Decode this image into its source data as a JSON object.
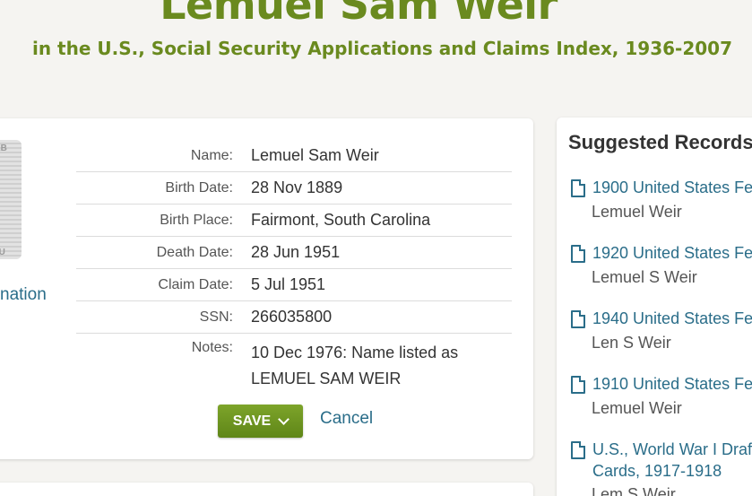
{
  "header": {
    "title": "Lemuel Sam Weir",
    "subtitle": "in the U.S., Social Security Applications and Claims Index, 1936-2007"
  },
  "image_panel": {
    "thumb_top_text": "EB",
    "thumb_bottom_text": "PU",
    "side_link": "nation"
  },
  "record": {
    "fields": [
      {
        "label": "Name:",
        "value": "Lemuel Sam Weir"
      },
      {
        "label": "Birth Date:",
        "value": "28 Nov 1889"
      },
      {
        "label": "Birth Place:",
        "value": "Fairmont, South Carolina"
      },
      {
        "label": "Death Date:",
        "value": "28 Jun 1951"
      },
      {
        "label": "Claim Date:",
        "value": "5 Jul 1951"
      },
      {
        "label": "SSN:",
        "value": "266035800"
      },
      {
        "label": "Notes:",
        "value": "10 Dec 1976: Name listed as LEMUEL SAM WEIR"
      }
    ],
    "save_label": "SAVE",
    "cancel_label": "Cancel"
  },
  "suggested": {
    "title": "Suggested Records",
    "items": [
      {
        "title": "1900 United States Fe",
        "name": "Lemuel Weir"
      },
      {
        "title": "1920 United States Fe",
        "name": "Lemuel S Weir"
      },
      {
        "title": "1940 United States Fe",
        "name": "Len S Weir"
      },
      {
        "title": "1910 United States Fe",
        "name": "Lemuel Weir"
      },
      {
        "title": "U.S., World War I Draf Cards, 1917-1918",
        "name": "Lem S Weir"
      }
    ]
  },
  "colors": {
    "brand_green": "#6a8a1f",
    "link_blue": "#2a6d89",
    "button_green": "#6f9521"
  }
}
